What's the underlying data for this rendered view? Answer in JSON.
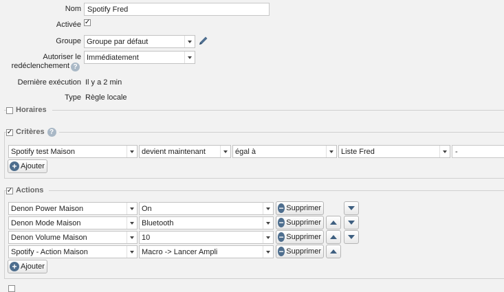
{
  "form": {
    "nom_label": "Nom",
    "nom_value": "Spotify Fred",
    "activee_label": "Activée",
    "activee_checked": true,
    "groupe_label": "Groupe",
    "groupe_value": "Groupe par défaut",
    "autoriser_label_1": "Autoriser le",
    "autoriser_label_2": "redéclenchement",
    "autoriser_value": "Immédiatement",
    "derniere_label": "Dernière exécution",
    "derniere_value": "Il y a 2 min",
    "type_label": "Type",
    "type_value": "Règle locale"
  },
  "horaires": {
    "legend": "Horaires",
    "checked": false
  },
  "criteres": {
    "legend": "Critères",
    "checked": true,
    "row": {
      "device": "Spotify test Maison",
      "condition": "devient maintenant",
      "operator": "égal à",
      "value": "Liste Fred",
      "extra": "-"
    },
    "add_label": "Ajouter"
  },
  "actions": {
    "legend": "Actions",
    "checked": true,
    "rows": [
      {
        "device": "Denon Power Maison",
        "value": "On",
        "delete_label": "Supprimer"
      },
      {
        "device": "Denon Mode Maison",
        "value": "Bluetooth",
        "delete_label": "Supprimer"
      },
      {
        "device": "Denon Volume Maison",
        "value": "10",
        "delete_label": "Supprimer"
      },
      {
        "device": "Spotify - Action Maison",
        "value": "Macro -> Lancer Ampli",
        "delete_label": "Supprimer"
      }
    ],
    "add_label": "Ajouter"
  },
  "icons": {
    "edit": "pencil-icon",
    "help": "help-icon",
    "add": "plus-circle-icon",
    "remove": "minus-circle-icon"
  },
  "colors": {
    "accent": "#4e6e8e",
    "background": "#f2f2f2"
  }
}
